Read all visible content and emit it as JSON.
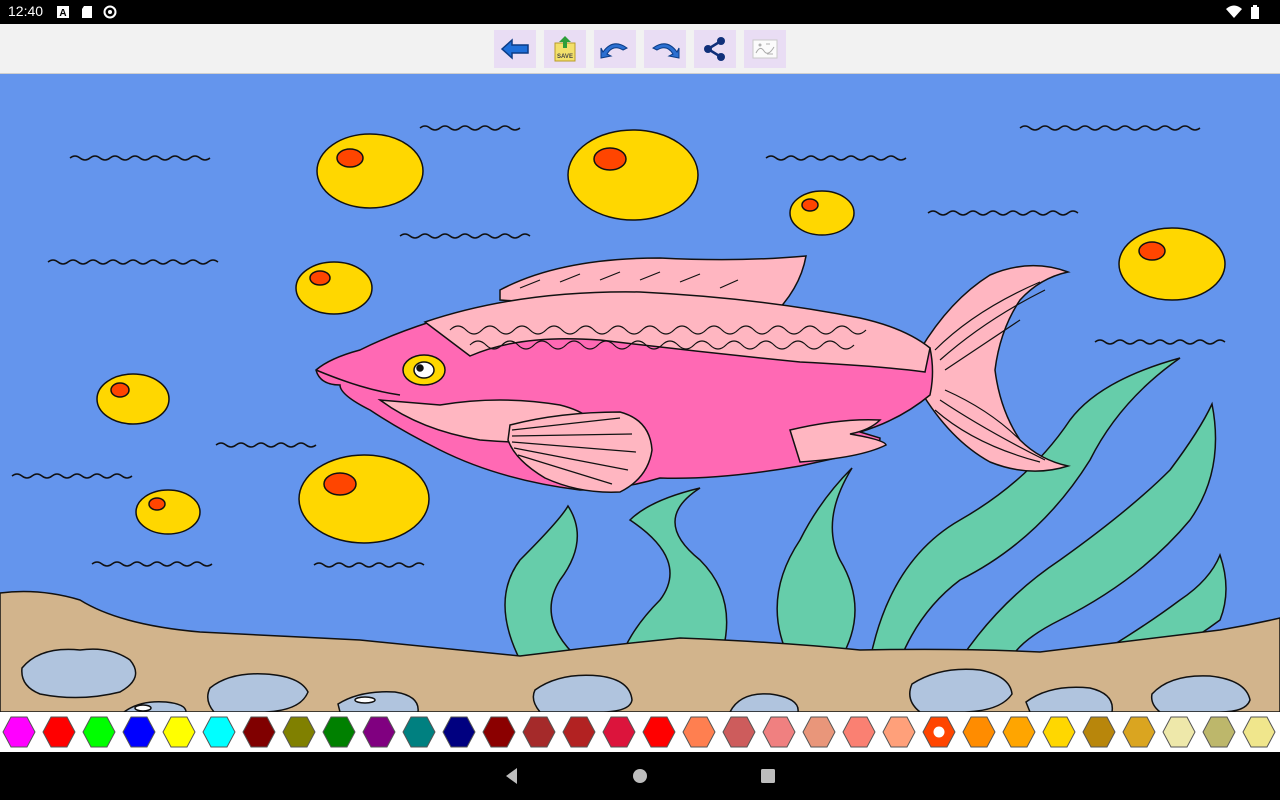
{
  "status_bar": {
    "time": "12:40",
    "left_icons": [
      "font-icon",
      "sd-card-icon",
      "sync-icon"
    ],
    "right_icons": [
      "wifi-icon",
      "battery-icon"
    ]
  },
  "toolbar": {
    "buttons": [
      {
        "name": "back-button",
        "icon": "back-arrow-icon"
      },
      {
        "name": "save-button",
        "icon": "save-icon",
        "label": "SAVE"
      },
      {
        "name": "undo-button",
        "icon": "undo-icon"
      },
      {
        "name": "redo-button",
        "icon": "redo-icon"
      },
      {
        "name": "share-button",
        "icon": "share-icon"
      },
      {
        "name": "gallery-button",
        "icon": "picture-thumbnail-icon"
      }
    ]
  },
  "drawing": {
    "subject": "fish-coloring-page",
    "colors": {
      "water": "#6495ed",
      "sand": "#d2b48c",
      "bubble": "#ffd700",
      "bubble_dot": "#ff4500",
      "fish_body": "#ff69b4",
      "fish_fin": "#ffb6c1",
      "seaweed": "#66cdaa",
      "rock": "#b0c4de",
      "eye": "#ffd700"
    }
  },
  "palette": {
    "selected_index": 23,
    "colors": [
      "#ff00ff",
      "#ff0000",
      "#00ff00",
      "#0000ff",
      "#ffff00",
      "#00ffff",
      "#800000",
      "#808000",
      "#008000",
      "#800080",
      "#008080",
      "#000080",
      "#8b0000",
      "#a52a2a",
      "#b22222",
      "#dc143c",
      "#ff0000",
      "#ff7f50",
      "#cd5c5c",
      "#f08080",
      "#e9967a",
      "#fa8072",
      "#ffa07a",
      "#ff4500",
      "#ff8c00",
      "#ffa500",
      "#ffd700",
      "#b8860b",
      "#daa520",
      "#eee8aa",
      "#bdb76b",
      "#f0e68c"
    ]
  },
  "nav_bar": {
    "buttons": [
      "back-triangle-icon",
      "home-circle-icon",
      "recents-square-icon"
    ]
  }
}
